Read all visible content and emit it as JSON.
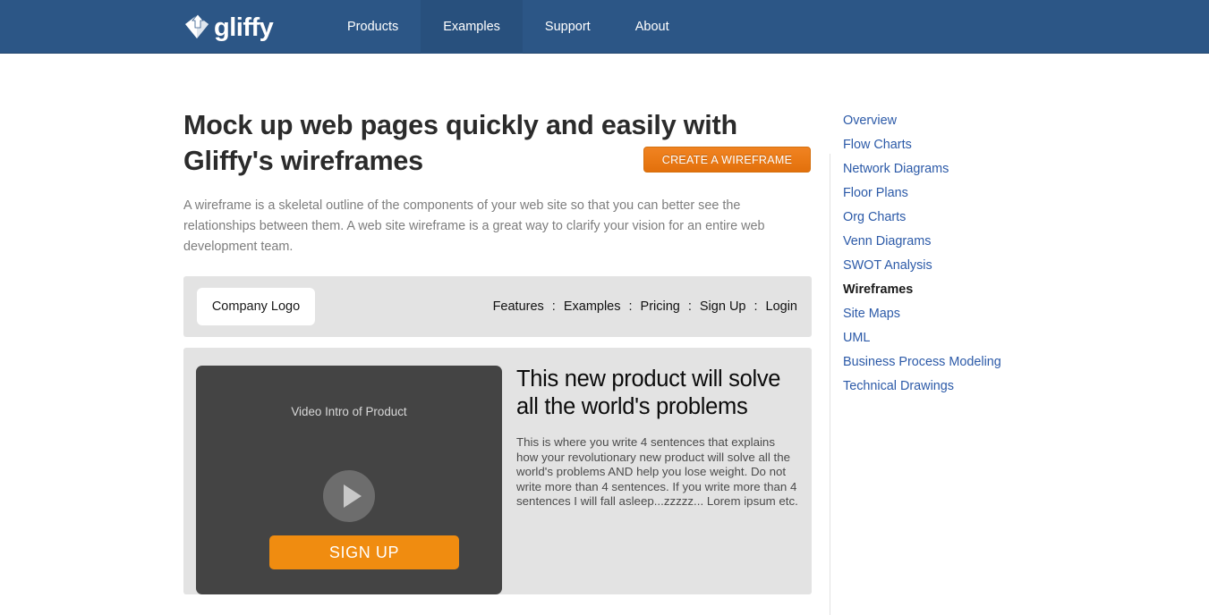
{
  "header": {
    "brand": {
      "logo_icon": "gliffy-diamond-logo-icon",
      "word": "gliffy"
    },
    "nav": [
      {
        "label": "Products",
        "active": false
      },
      {
        "label": "Examples",
        "active": true
      },
      {
        "label": "Support",
        "active": false
      },
      {
        "label": "About",
        "active": false
      }
    ],
    "bg_color": "#2c5686",
    "active_bg_color": "#28507d"
  },
  "main": {
    "headline": "Mock up web pages quickly and easily with Gliffy's wireframes",
    "cta_label": "CREATE A WIREFRAME",
    "cta_color": "#ea7a16",
    "intro": "A wireframe is a skeletal outline of the components of your web site so that you can better see the relationships between them. A web site wireframe is a great way to clarify your vision for an entire web development team."
  },
  "wireframe": {
    "nav_bar": {
      "logo_label": "Company Logo",
      "links": [
        "Features",
        "Examples",
        "Pricing",
        "Sign Up",
        "Login"
      ],
      "separator": ":"
    },
    "hero": {
      "video_label": "Video Intro of Product",
      "play_icon": "play-triangle-icon",
      "heading": "This new product will solve all the world's problems",
      "body": "This is where you write 4 sentences that explains how your revolutionary new product will solve all the world's problems AND help you lose weight. Do not write more than 4 sentences.  If you write more than 4 sentences I will fall asleep...zzzzz... Lorem ipsum etc.",
      "signup_label": "SIGN UP",
      "signup_color": "#f08c10"
    },
    "panel_bg": "#e3e3e3"
  },
  "sidebar": {
    "items": [
      {
        "label": "Overview",
        "current": false
      },
      {
        "label": "Flow Charts",
        "current": false
      },
      {
        "label": "Network Diagrams",
        "current": false
      },
      {
        "label": "Floor Plans",
        "current": false
      },
      {
        "label": "Org Charts",
        "current": false
      },
      {
        "label": "Venn Diagrams",
        "current": false
      },
      {
        "label": "SWOT Analysis",
        "current": false
      },
      {
        "label": "Wireframes",
        "current": true
      },
      {
        "label": "Site Maps",
        "current": false
      },
      {
        "label": "UML",
        "current": false
      },
      {
        "label": "Business Process Modeling",
        "current": false
      },
      {
        "label": "Technical Drawings",
        "current": false
      }
    ],
    "link_color": "#2c5aa8"
  }
}
